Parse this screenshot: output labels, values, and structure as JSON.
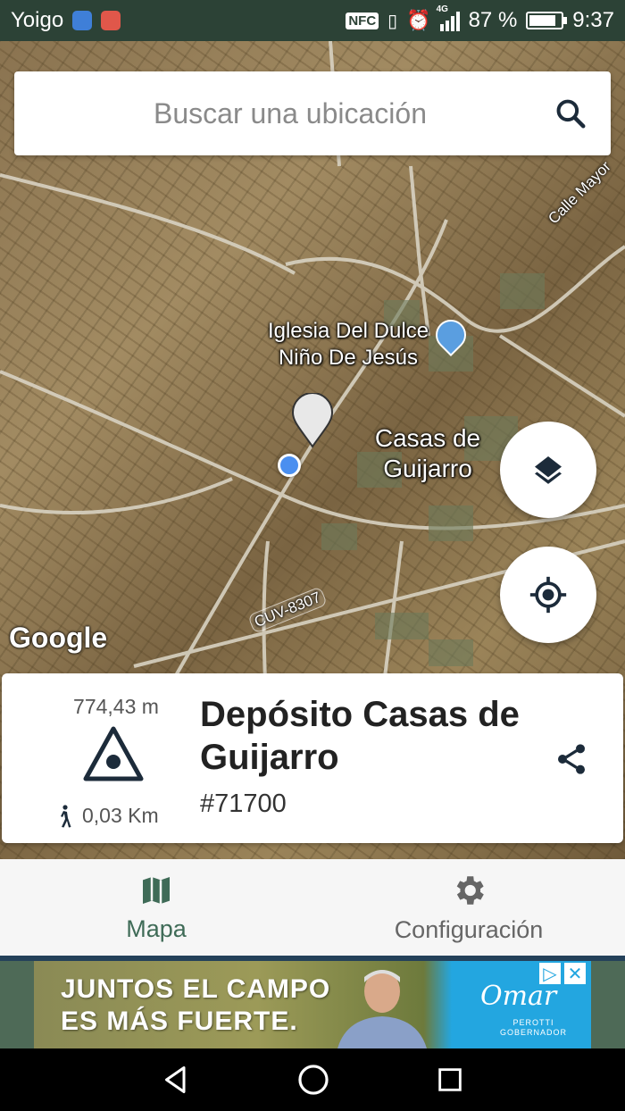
{
  "status_bar": {
    "carrier": "Yoigo",
    "nfc": "NFC",
    "network": "4G",
    "battery_text": "87 %",
    "battery_level": 0.87,
    "time": "9:37"
  },
  "search": {
    "placeholder": "Buscar una ubicación",
    "icon": "search-icon"
  },
  "map": {
    "labels": {
      "church": "Iglesia Del Dulce\nNiño De Jesús",
      "town": "Casas de\nGuijarro",
      "street": "Calle Mayor",
      "road": "CUV-8307"
    },
    "attribution": "Google",
    "layers_icon": "layers-icon",
    "location_icon": "my-location-icon"
  },
  "card": {
    "elevation": "774,43 m",
    "distance": "0,03 Km",
    "name": "Depósito Casas de Guijarro",
    "id": "#71700",
    "icons": [
      "triangle-marker-icon",
      "walk-icon",
      "share-icon"
    ]
  },
  "nav": {
    "items": [
      {
        "label": "Mapa",
        "icon": "map-icon",
        "active": true
      },
      {
        "label": "Configuración",
        "icon": "gear-icon",
        "active": false
      }
    ],
    "active_color": "#3f6b57"
  },
  "ad": {
    "headline_line1": "JUNTOS EL CAMPO",
    "headline_line2": "ES MÁS FUERTE.",
    "brand": "Omar",
    "brand_sub": "PEROTTI\nGOBERNADOR"
  },
  "colors": {
    "status_bar": "#2c4236",
    "accent": "#3f6b57",
    "location_dot": "#4a8ff0"
  }
}
